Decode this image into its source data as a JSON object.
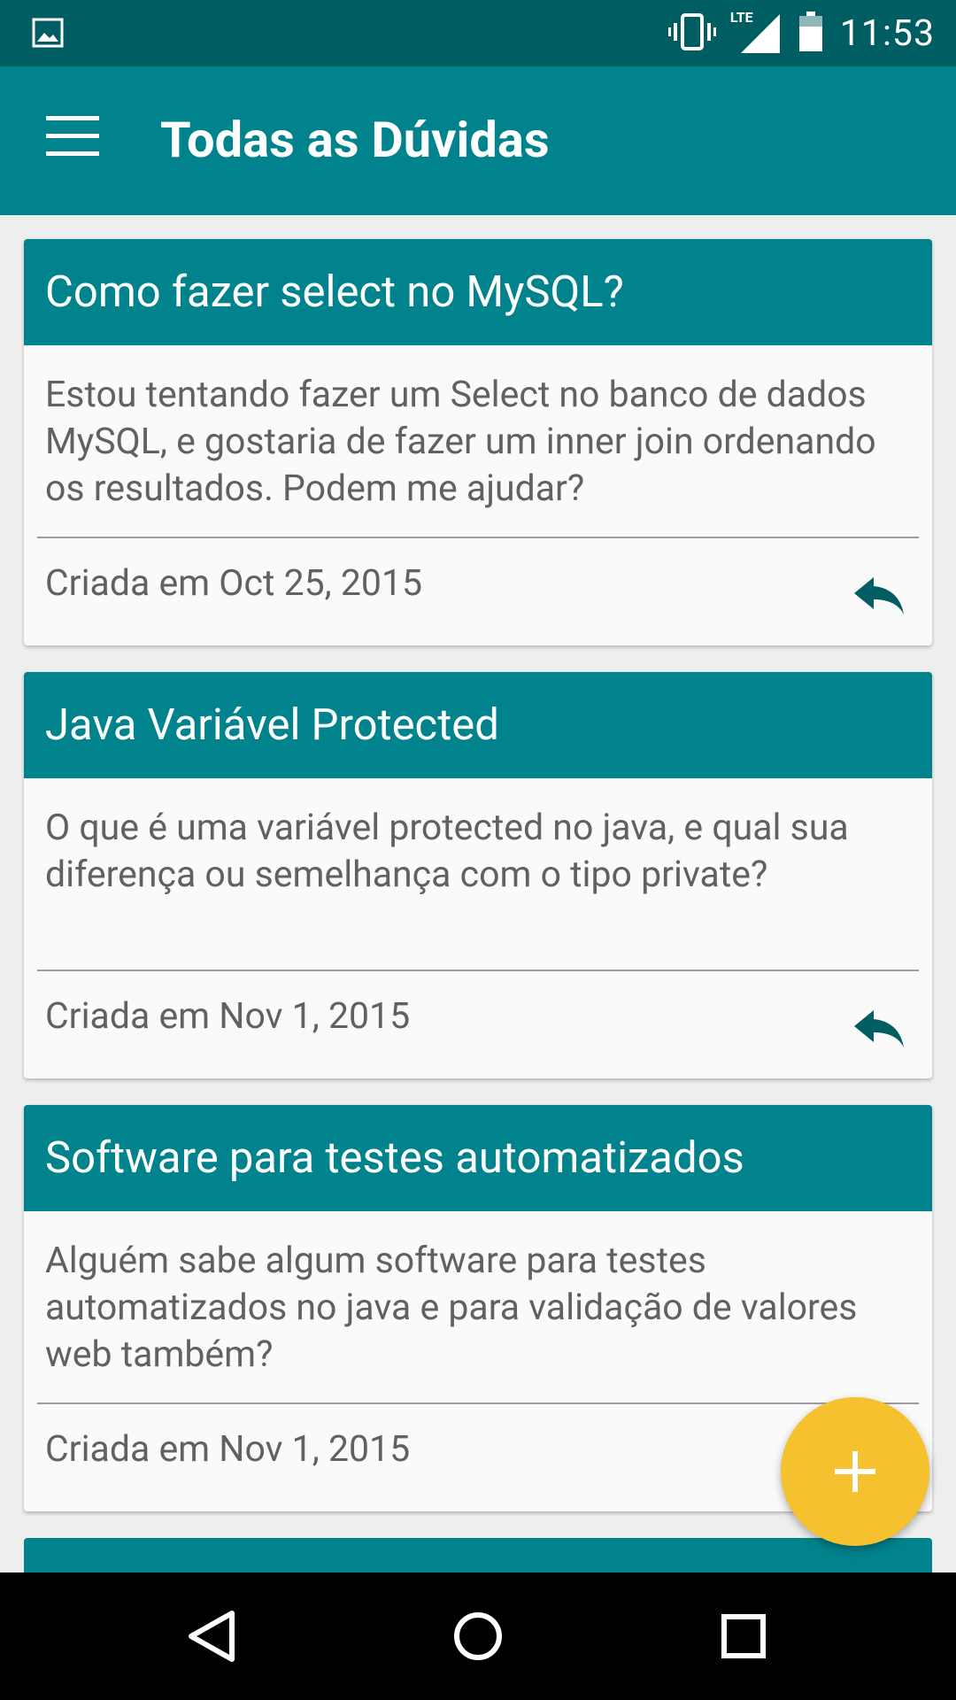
{
  "status_bar": {
    "time": "11:53",
    "network_label": "LTE",
    "icons": [
      "image-icon",
      "vibrate-icon",
      "signal-icon",
      "battery-icon"
    ]
  },
  "app_bar": {
    "title": "Todas as Dúvidas",
    "menu_icon": "hamburger-menu-icon"
  },
  "questions": [
    {
      "title": "Como fazer select no MySQL?",
      "body": "Estou tentando fazer um Select no banco de dados MySQL, e gostaria de fazer um inner join ordenando os resultados. Podem me ajudar?",
      "created": "Criada em Oct 25, 2015"
    },
    {
      "title": "Java Variável Protected",
      "body": "O que é uma variável protected no java, e qual sua diferença ou semelhança com o tipo private?",
      "created": "Criada em Nov 1, 2015"
    },
    {
      "title": "Software para testes automatizados",
      "body": "Alguém sabe algum software para testes automatizados no java e para validação de valores web também?",
      "created": "Criada em Nov 1, 2015"
    }
  ],
  "fab": {
    "icon": "plus-icon"
  },
  "colors": {
    "status_bar": "#005E63",
    "primary": "#00838C",
    "accent": "#F6C12E",
    "reply_icon": "#005E63",
    "background": "#EEEEEE"
  },
  "nav_bar": {
    "buttons": [
      "back-icon",
      "home-icon",
      "recents-icon"
    ]
  }
}
